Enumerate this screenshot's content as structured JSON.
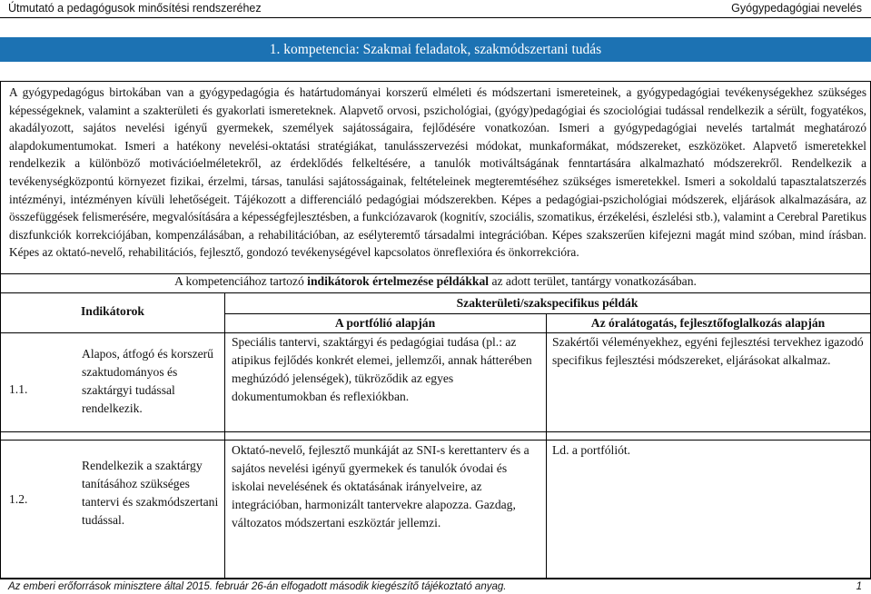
{
  "header": {
    "left": "Útmutató a pedagógusok minősítési rendszeréhez",
    "right": "Gyógypedagógiai nevelés"
  },
  "banner": {
    "title": "1. kompetencia: Szakmai feladatok, szakmódszertani tudás"
  },
  "intro": {
    "text": "A gyógypedagógus birtokában van a gyógypedagógia és határtudományai korszerű elméleti és módszertani ismereteinek, a gyógypedagógiai tevékenységekhez szükséges képességeknek, valamint a szakterületi és gyakorlati ismereteknek. Alapvető orvosi, pszichológiai, (gyógy)pedagógiai és szociológiai tudással rendelkezik a sérült, fogyatékos, akadályozott, sajátos nevelési igényű gyermekek, személyek sajátosságaira, fejlődésére vonatkozóan. Ismeri a gyógypedagógiai nevelés tartalmát meghatározó alapdokumentumokat. Ismeri a hatékony nevelési-oktatási stratégiákat, tanulásszervezési módokat, munkaformákat, módszereket, eszközöket. Alapvető ismeretekkel rendelkezik a különböző motivációelméletekről, az érdeklődés felkeltésére, a tanulók motiváltságának fenntartására alkalmazható módszerekről. Rendelkezik a tevékenységközpontú környezet fizikai, érzelmi, társas, tanulási sajátosságainak, feltételeinek megteremtéséhez szükséges ismeretekkel. Ismeri a sokoldalú tapasztalatszerzés intézményi, intézményen kívüli lehetőségeit. Tájékozott a differenciáló pedagógiai módszerekben. Képes a pedagógiai-pszichológiai módszerek, eljárások alkalmazására, az összefüggések felismerésére, megvalósítására a képességfejlesztésben, a funkciózavarok (kognitív, szociális, szomatikus, érzékelési, észlelési stb.), valamint a Cerebral Paretikus diszfunkciók korrekciójában, kompenzálásában, a rehabilitációban, az esélyteremtő társadalmi integrációban. Képes szakszerűen kifejezni magát mind szóban, mind írásban. Képes az oktató-nevelő, rehabilitációs, fejlesztő, gondozó tevékenységével kapcsolatos önreflexióra és önkorrekcióra."
  },
  "caption": {
    "before": "A kompetenciához tartozó ",
    "bold": "indikátorok értelmezése példákkal",
    "after": " az adott terület, tantárgy vonatkozásában."
  },
  "table": {
    "col_indicators": "Indikátorok",
    "col_examples": "Szakterületi/szakspecifikus példák",
    "col_portfolio": "A portfólió alapján",
    "col_visit": "Az óralátogatás, fejlesztőfoglalkozás alapján",
    "rows": [
      {
        "num": "1.1.",
        "indicator": "Alapos, átfogó és korszerű szaktudományos és szaktárgyi tudással rendelkezik.",
        "portfolio": "Speciális tantervi, szaktárgyi és pedagógiai tudása (pl.: az atipikus fejlődés konkrét elemei, jellemzői, annak hátterében meghúzódó jelenségek), tükröződik az egyes dokumentumokban és reflexiókban.",
        "visit": "Szakértői véleményekhez, egyéni fejlesztési tervekhez igazodó specifikus fejlesztési módszereket, eljárásokat alkalmaz."
      },
      {
        "num": "1.2.",
        "indicator": "Rendelkezik a szaktárgy tanításához szükséges tantervi és szakmódszertani tudással.",
        "portfolio": "Oktató-nevelő, fejlesztő munkáját az SNI-s kerettanterv és a sajátos nevelési igényű gyermekek és tanulók óvodai és iskolai nevelésének és oktatásának irányelveire, az integrációban, harmonizált tantervekre alapozza. Gazdag, változatos módszertani eszköztár jellemzi.",
        "visit": "Ld. a portfóliót."
      }
    ]
  },
  "footer": {
    "text": "Az emberi erőforrások minisztere által 2015. február 26-án elfogadott második kiegészítő tájékoztató anyag.",
    "page": "1"
  }
}
